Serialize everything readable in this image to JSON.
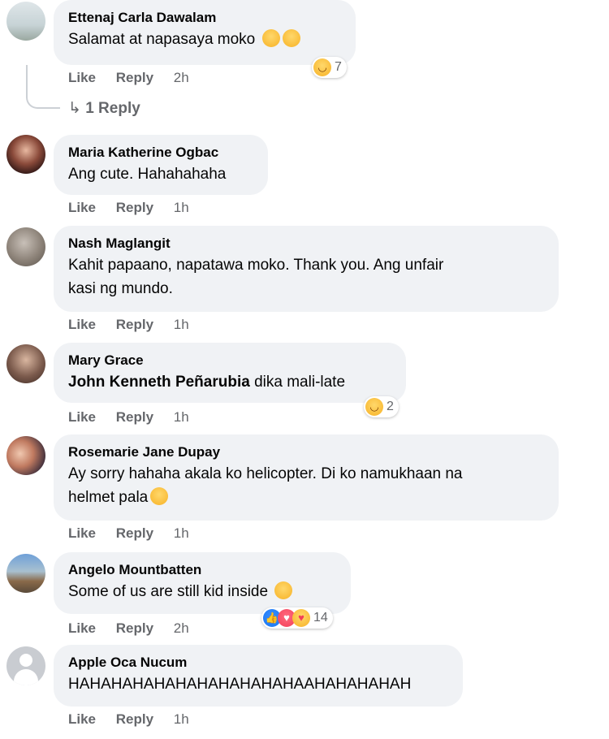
{
  "actions": {
    "like": "Like",
    "reply": "Reply"
  },
  "colors": {
    "bubble": "#f0f2f5",
    "meta": "#65676b",
    "like_blue": "#1877f2",
    "love_red": "#f33e58",
    "haha_yellow": "#f7b125"
  },
  "comments": [
    {
      "author": "Ettenaj Carla Dawalam",
      "text": "Salamat at napasaya moko",
      "time": "2h",
      "reaction_count": "7",
      "reactions": [
        "haha"
      ],
      "inline_emojis": [
        "crying-laughing",
        "crying-laughing"
      ],
      "replies_label": "1 Reply"
    },
    {
      "author": "Maria Katherine Ogbac",
      "text": "Ang cute. Hahahahaha",
      "time": "1h"
    },
    {
      "author": "Nash Maglangit",
      "text_line1": "Kahit papaano, napatawa moko. Thank you. Ang unfair",
      "text_line2": "kasi ng mundo.",
      "time": "1h"
    },
    {
      "author": "Mary Grace",
      "mention": "John Kenneth Peñarubia",
      "text": "dika mali-late",
      "time": "1h",
      "reaction_count": "2",
      "reactions": [
        "haha"
      ]
    },
    {
      "author": "Rosemarie Jane Dupay",
      "text_line1": "Ay sorry hahaha akala ko helicopter. Di ko namukhaan na",
      "text_line2": "helmet pala",
      "inline_emojis": [
        "rolling-laughing"
      ],
      "time": "1h"
    },
    {
      "author": "Angelo Mountbatten",
      "text": "Some of us are still kid inside",
      "inline_emojis": [
        "smiling-face"
      ],
      "time": "2h",
      "reaction_count": "14",
      "reactions": [
        "like",
        "love",
        "care"
      ]
    },
    {
      "author": "Apple Oca Nucum",
      "text": "HAHAHAHAHAHAHAHAHAHAHAAHAHAHAHAH",
      "time": "1h"
    }
  ]
}
